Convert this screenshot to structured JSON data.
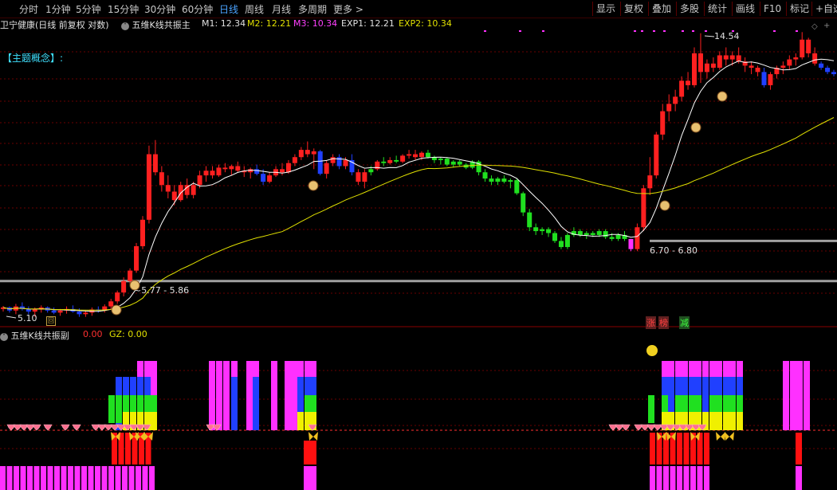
{
  "toolbar": {
    "left": [
      {
        "label": "分时",
        "active": false
      },
      {
        "label": "1分钟",
        "active": false
      },
      {
        "label": "5分钟",
        "active": false
      },
      {
        "label": "15分钟",
        "active": false
      },
      {
        "label": "30分钟",
        "active": false
      },
      {
        "label": "60分钟",
        "active": false
      },
      {
        "label": "日线",
        "active": true
      },
      {
        "label": "周线",
        "active": false
      },
      {
        "label": "月线",
        "active": false
      },
      {
        "label": "多周期",
        "active": false
      },
      {
        "label": "更多",
        "active": false
      }
    ],
    "right": [
      "显示",
      "复权",
      "叠加",
      "多股",
      "统计",
      "画线",
      "F10",
      "标记",
      "+自选"
    ]
  },
  "main_header": {
    "stock": "卫宁健康(日线 前复权 对数)",
    "indicator": "五维K线共振主",
    "m1": "M1: 12.34",
    "m2": "M2: 12.21",
    "m3": "M3: 10.34",
    "exp1": "EXP1: 12.21",
    "exp2": "EXP2: 10.34"
  },
  "theme_label": "【主题概念】:",
  "annotations": {
    "high_price": "14.54",
    "low_price": "5.10",
    "range_low": "~5.77 - 5.86",
    "range_high": "6.70 - 6.80"
  },
  "badges": [
    "涨",
    "榜",
    "减"
  ],
  "sub_header": {
    "indicator": "五维K线共振副",
    "v1": "0.00",
    "gz": "GZ: 0.00"
  },
  "colors": {
    "up": "#ff2020",
    "down_blue": "#2040ff",
    "down_green": "#20e020",
    "magenta": "#ff30ff",
    "yellow_ma": "#e0e000",
    "white_ma": "#ffffff",
    "grid": "#6a0000",
    "level": "#a0a0a0"
  },
  "chart_data": {
    "type": "candlestick",
    "y_scale": "log",
    "bars": [
      [
        5.25,
        5.31,
        5.2,
        5.28,
        "r"
      ],
      [
        5.28,
        5.3,
        5.18,
        5.22,
        "b"
      ],
      [
        5.22,
        5.35,
        5.15,
        5.3,
        "r"
      ],
      [
        5.3,
        5.38,
        5.22,
        5.25,
        "b"
      ],
      [
        5.25,
        5.3,
        5.15,
        5.2,
        "b"
      ],
      [
        5.2,
        5.28,
        5.1,
        5.24,
        "r"
      ],
      [
        5.24,
        5.32,
        5.18,
        5.28,
        "r"
      ],
      [
        5.28,
        5.3,
        5.18,
        5.22,
        "b"
      ],
      [
        5.22,
        5.28,
        5.15,
        5.18,
        "b"
      ],
      [
        5.18,
        5.25,
        5.12,
        5.22,
        "r"
      ],
      [
        5.22,
        5.3,
        5.16,
        5.25,
        "r"
      ],
      [
        5.25,
        5.32,
        5.18,
        5.2,
        "b"
      ],
      [
        5.2,
        5.26,
        5.1,
        5.15,
        "b"
      ],
      [
        5.15,
        5.22,
        5.1,
        5.18,
        "r"
      ],
      [
        5.18,
        5.28,
        5.12,
        5.24,
        "r"
      ],
      [
        5.24,
        5.3,
        5.18,
        5.22,
        "b"
      ],
      [
        5.22,
        5.34,
        5.18,
        5.3,
        "r"
      ],
      [
        5.3,
        5.45,
        5.25,
        5.4,
        "r"
      ],
      [
        5.4,
        5.62,
        5.35,
        5.58,
        "r"
      ],
      [
        5.58,
        5.9,
        5.5,
        5.82,
        "r"
      ],
      [
        5.82,
        6.1,
        5.75,
        6.05,
        "r"
      ],
      [
        6.05,
        6.7,
        6.0,
        6.62,
        "r"
      ],
      [
        6.62,
        7.4,
        6.55,
        7.3,
        "r"
      ],
      [
        7.3,
        9.6,
        7.2,
        9.3,
        "r"
      ],
      [
        9.3,
        9.8,
        8.6,
        8.7,
        "r"
      ],
      [
        8.7,
        8.9,
        8.1,
        8.3,
        "r"
      ],
      [
        8.3,
        8.6,
        7.9,
        8.1,
        "r"
      ],
      [
        8.1,
        8.3,
        7.7,
        7.85,
        "r"
      ],
      [
        7.85,
        8.4,
        7.8,
        8.3,
        "r"
      ],
      [
        8.3,
        8.5,
        7.9,
        8.0,
        "r"
      ],
      [
        8.0,
        8.4,
        7.9,
        8.3,
        "r"
      ],
      [
        8.3,
        8.75,
        8.2,
        8.6,
        "r"
      ],
      [
        8.6,
        8.9,
        8.4,
        8.75,
        "r"
      ],
      [
        8.75,
        8.9,
        8.5,
        8.6,
        "r"
      ],
      [
        8.6,
        8.95,
        8.55,
        8.85,
        "r"
      ],
      [
        8.85,
        9.0,
        8.7,
        8.8,
        "r"
      ],
      [
        8.8,
        8.95,
        8.6,
        8.9,
        "r"
      ],
      [
        8.9,
        9.05,
        8.7,
        8.75,
        "r"
      ],
      [
        8.75,
        8.9,
        8.55,
        8.7,
        "r"
      ],
      [
        8.7,
        8.85,
        8.5,
        8.8,
        "r"
      ],
      [
        8.8,
        8.95,
        8.6,
        8.65,
        "b"
      ],
      [
        8.65,
        8.8,
        8.3,
        8.4,
        "b"
      ],
      [
        8.4,
        8.7,
        8.35,
        8.6,
        "r"
      ],
      [
        8.6,
        8.9,
        8.55,
        8.8,
        "r"
      ],
      [
        8.8,
        9.0,
        8.6,
        8.7,
        "r"
      ],
      [
        8.7,
        9.1,
        8.65,
        9.0,
        "r"
      ],
      [
        9.0,
        9.3,
        8.9,
        9.2,
        "r"
      ],
      [
        9.2,
        9.55,
        9.1,
        9.45,
        "r"
      ],
      [
        9.45,
        9.75,
        9.2,
        9.3,
        "r"
      ],
      [
        9.3,
        9.5,
        8.8,
        9.4,
        "r"
      ],
      [
        9.4,
        9.45,
        8.6,
        8.65,
        "b"
      ],
      [
        8.65,
        9.1,
        8.5,
        9.0,
        "r"
      ],
      [
        9.0,
        9.3,
        8.9,
        9.2,
        "r"
      ],
      [
        9.2,
        9.3,
        8.8,
        8.9,
        "b"
      ],
      [
        8.9,
        9.2,
        8.8,
        9.1,
        "r"
      ],
      [
        9.1,
        9.3,
        8.6,
        8.7,
        "b"
      ],
      [
        8.7,
        8.8,
        8.3,
        8.4,
        "r"
      ],
      [
        8.4,
        8.8,
        8.2,
        8.7,
        "r"
      ],
      [
        8.7,
        8.9,
        8.6,
        8.8,
        "g"
      ],
      [
        8.8,
        9.1,
        8.75,
        9.05,
        "r"
      ],
      [
        9.05,
        9.2,
        8.9,
        9.0,
        "g"
      ],
      [
        9.0,
        9.2,
        8.95,
        9.1,
        "r"
      ],
      [
        9.1,
        9.25,
        9.0,
        9.05,
        "g"
      ],
      [
        9.05,
        9.3,
        9.0,
        9.25,
        "r"
      ],
      [
        9.25,
        9.45,
        9.15,
        9.3,
        "r"
      ],
      [
        9.3,
        9.45,
        9.1,
        9.2,
        "r"
      ],
      [
        9.2,
        9.4,
        9.1,
        9.35,
        "r"
      ],
      [
        9.35,
        9.45,
        9.15,
        9.2,
        "g"
      ],
      [
        9.2,
        9.25,
        9.0,
        9.1,
        "g"
      ],
      [
        9.1,
        9.2,
        8.95,
        9.15,
        "g"
      ],
      [
        9.15,
        9.2,
        8.9,
        8.95,
        "g"
      ],
      [
        8.95,
        9.1,
        8.85,
        9.05,
        "g"
      ],
      [
        9.05,
        9.1,
        8.9,
        8.95,
        "g"
      ],
      [
        8.95,
        9.0,
        8.8,
        8.85,
        "g"
      ],
      [
        8.85,
        9.1,
        8.8,
        9.05,
        "g"
      ],
      [
        9.05,
        9.1,
        8.6,
        8.7,
        "g"
      ],
      [
        8.7,
        8.8,
        8.4,
        8.5,
        "g"
      ],
      [
        8.5,
        8.6,
        8.3,
        8.4,
        "g"
      ],
      [
        8.4,
        8.55,
        8.3,
        8.5,
        "g"
      ],
      [
        8.5,
        8.6,
        8.35,
        8.4,
        "g"
      ],
      [
        8.4,
        8.5,
        8.2,
        8.45,
        "g"
      ],
      [
        8.45,
        8.5,
        8.0,
        8.05,
        "g"
      ],
      [
        8.05,
        8.1,
        7.4,
        7.5,
        "g"
      ],
      [
        7.5,
        7.6,
        7.0,
        7.1,
        "g"
      ],
      [
        7.1,
        7.2,
        6.9,
        7.0,
        "g"
      ],
      [
        7.0,
        7.1,
        6.9,
        7.05,
        "g"
      ],
      [
        7.05,
        7.1,
        6.85,
        6.95,
        "g"
      ],
      [
        6.95,
        7.0,
        6.7,
        6.75,
        "g"
      ],
      [
        6.75,
        6.85,
        6.55,
        6.6,
        "g"
      ],
      [
        6.6,
        6.95,
        6.55,
        6.9,
        "g"
      ],
      [
        6.9,
        7.1,
        6.85,
        7.0,
        "g"
      ],
      [
        7.0,
        7.05,
        6.85,
        6.9,
        "g"
      ],
      [
        6.9,
        7.0,
        6.8,
        6.95,
        "g"
      ],
      [
        6.95,
        7.0,
        6.85,
        6.9,
        "g"
      ],
      [
        6.9,
        7.05,
        6.85,
        7.0,
        "g"
      ],
      [
        7.0,
        7.05,
        6.8,
        6.85,
        "g"
      ],
      [
        6.85,
        6.95,
        6.75,
        6.8,
        "g"
      ],
      [
        6.8,
        6.95,
        6.75,
        6.9,
        "g"
      ],
      [
        6.9,
        7.0,
        6.75,
        6.8,
        "g"
      ],
      [
        6.8,
        6.8,
        6.5,
        6.55,
        "m"
      ],
      [
        6.55,
        7.2,
        6.5,
        7.1,
        "r"
      ],
      [
        7.1,
        8.3,
        7.0,
        8.2,
        "r"
      ],
      [
        8.2,
        9.2,
        8.0,
        8.6,
        "r"
      ],
      [
        8.6,
        10.1,
        8.5,
        10.0,
        "r"
      ],
      [
        10.0,
        11.2,
        9.8,
        10.9,
        "r"
      ],
      [
        10.9,
        11.6,
        10.5,
        11.2,
        "r"
      ],
      [
        11.2,
        11.8,
        10.9,
        11.5,
        "r"
      ],
      [
        11.5,
        12.4,
        11.3,
        12.2,
        "r"
      ],
      [
        12.2,
        12.6,
        11.8,
        12.0,
        "r"
      ],
      [
        12.0,
        13.8,
        11.9,
        13.5,
        "r"
      ],
      [
        13.5,
        14.54,
        12.1,
        12.6,
        "r"
      ],
      [
        12.6,
        13.2,
        12.3,
        13.0,
        "r"
      ],
      [
        13.0,
        13.3,
        12.6,
        12.8,
        "r"
      ],
      [
        12.8,
        13.6,
        12.7,
        13.4,
        "r"
      ],
      [
        13.4,
        13.8,
        12.9,
        13.2,
        "r"
      ],
      [
        13.2,
        13.6,
        12.9,
        13.4,
        "r"
      ],
      [
        13.4,
        13.8,
        13.0,
        13.1,
        "r"
      ],
      [
        13.1,
        13.3,
        12.6,
        12.9,
        "r"
      ],
      [
        12.9,
        13.1,
        12.5,
        12.8,
        "r"
      ],
      [
        12.8,
        12.9,
        12.4,
        12.6,
        "r"
      ],
      [
        12.6,
        12.8,
        11.9,
        12.0,
        "b"
      ],
      [
        12.0,
        12.6,
        11.8,
        12.5,
        "r"
      ],
      [
        12.5,
        12.9,
        12.3,
        12.8,
        "r"
      ],
      [
        12.8,
        13.1,
        12.5,
        12.9,
        "r"
      ],
      [
        12.9,
        13.4,
        12.7,
        13.2,
        "r"
      ],
      [
        13.2,
        13.5,
        12.9,
        13.3,
        "r"
      ],
      [
        13.3,
        14.6,
        13.2,
        14.2,
        "r"
      ],
      [
        14.2,
        14.3,
        13.3,
        13.5,
        "r"
      ],
      [
        13.5,
        13.8,
        12.9,
        13.0,
        "r"
      ],
      [
        13.0,
        13.1,
        12.7,
        12.8,
        "b"
      ],
      [
        12.8,
        12.9,
        12.5,
        12.6,
        "b"
      ],
      [
        12.6,
        12.7,
        12.4,
        12.5,
        "b"
      ]
    ]
  }
}
